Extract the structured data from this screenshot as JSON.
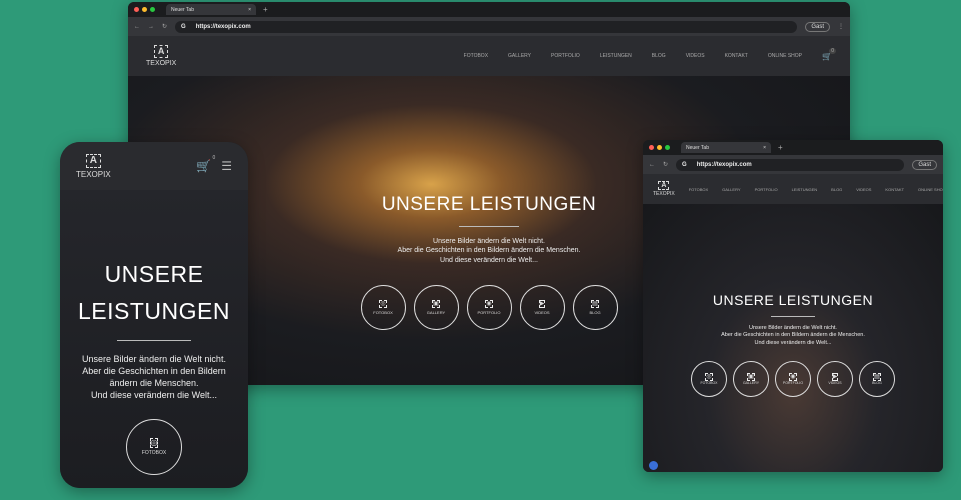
{
  "browser": {
    "tab_title": "Neuer Tab",
    "url": "https://texopix.com",
    "profile": "Gast"
  },
  "site": {
    "logo": "TEXOPIX",
    "menu": [
      "FOTOBOX",
      "GALLERY",
      "PORTFOLIO",
      "LEISTUNGEN",
      "BLOG",
      "VIDEOS",
      "KONTAKT",
      "ONLINE SHOP"
    ],
    "cart_count": "0",
    "headline": "UNSERE LEISTUNGEN",
    "headline_line1": "UNSERE",
    "headline_line2": "LEISTUNGEN",
    "tagline": [
      "Unsere Bilder ändern die Welt nicht.",
      "Aber die Geschichten in den Bildern ändern die Menschen.",
      "Und diese verändern die Welt..."
    ],
    "services": [
      "FOTOBOX",
      "GALLERY",
      "PORTFOLIO",
      "VIDEOS",
      "BLOG"
    ]
  },
  "colors": {
    "background": "#2e9a78"
  }
}
